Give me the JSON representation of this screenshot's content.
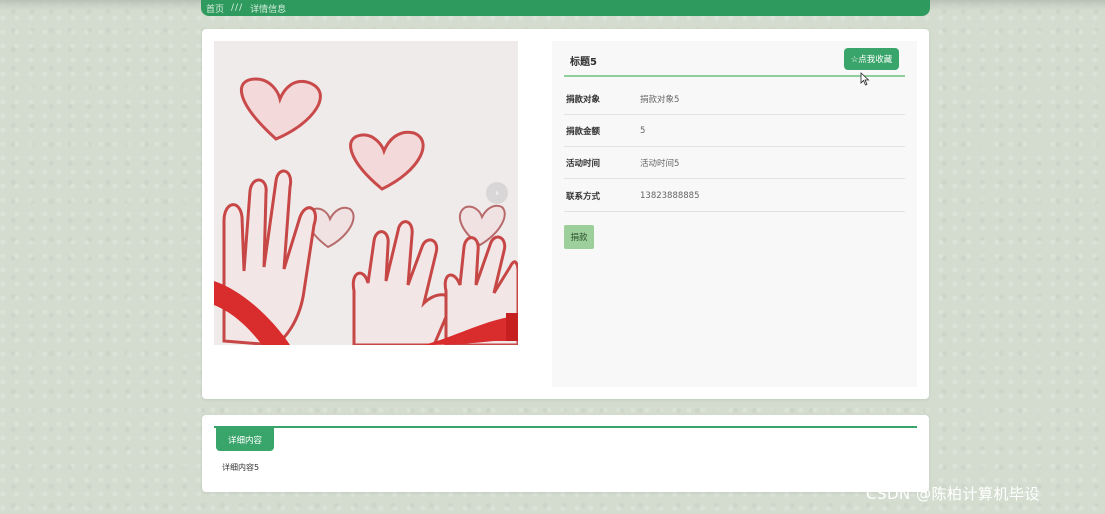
{
  "breadcrumb": {
    "home": "首页",
    "separator": "///",
    "current": "详情信息"
  },
  "detail": {
    "title": "标题5",
    "favorite_button": "☆点我收藏",
    "fields": [
      {
        "label": "捐款对象",
        "value": "捐款对象5"
      },
      {
        "label": "捐款金额",
        "value": "5"
      },
      {
        "label": "活动时间",
        "value": "活动时间5"
      },
      {
        "label": "联系方式",
        "value": "13823888885"
      }
    ],
    "donate_button": "捐款"
  },
  "content_tab": {
    "label": "详细内容",
    "text": "详细内容5"
  },
  "watermark": "CSDN @陈柏计算机毕设",
  "colors": {
    "accent": "#3aa56a",
    "donate": "#9ccf9a",
    "background": "#d3dccf"
  },
  "icons": [
    "hearts-illustration",
    "carousel-arrow-icon",
    "mouse-cursor-icon"
  ]
}
